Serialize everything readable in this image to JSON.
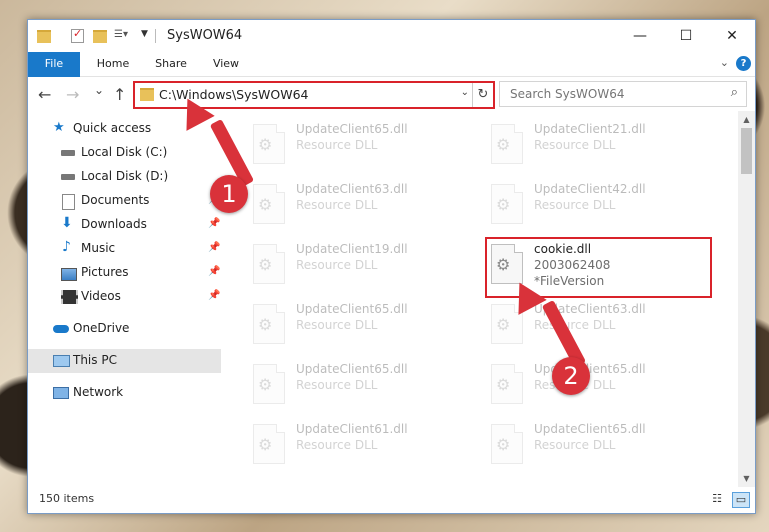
{
  "window": {
    "title": "SysWOW64",
    "controls": {
      "minimize": "—",
      "maximize": "☐",
      "close": "✕"
    }
  },
  "ribbon": {
    "tabs": [
      "File",
      "Home",
      "Share",
      "View"
    ],
    "help": "?"
  },
  "nav_buttons": {
    "back": "←",
    "forward": "→",
    "recent": "⌄",
    "up": "↑"
  },
  "address": {
    "path": "C:\\Windows\\SysWOW64",
    "dropdown": "⌄",
    "refresh": "↻"
  },
  "search": {
    "placeholder": "Search SysWOW64"
  },
  "sidebar": {
    "items": [
      {
        "label": "Quick access",
        "icon": "star-icon"
      },
      {
        "label": "Local Disk (C:)",
        "icon": "drive-icon"
      },
      {
        "label": "Local Disk (D:)",
        "icon": "drive-icon"
      },
      {
        "label": "Documents",
        "icon": "documents-icon"
      },
      {
        "label": "Downloads",
        "icon": "download-icon"
      },
      {
        "label": "Music",
        "icon": "music-icon"
      },
      {
        "label": "Pictures",
        "icon": "pictures-icon"
      },
      {
        "label": "Videos",
        "icon": "videos-icon"
      },
      {
        "label": "OneDrive",
        "icon": "cloud-icon"
      },
      {
        "label": "This PC",
        "icon": "computer-icon"
      },
      {
        "label": "Network",
        "icon": "network-icon"
      }
    ]
  },
  "files": [
    {
      "name": "UpdateClient65.dll",
      "type": "Resource DLL"
    },
    {
      "name": "UpdateClient21.dll",
      "type": "Resource DLL"
    },
    {
      "name": "UpdateClient63.dll",
      "type": "Resource DLL"
    },
    {
      "name": "UpdateClient42.dll",
      "type": "Resource DLL"
    },
    {
      "name": "UpdateClient19.dll",
      "type": "Resource DLL"
    },
    {
      "name": "UpdateClient65.dll",
      "type": "Resource DLL"
    },
    {
      "name": "UpdateClient63.dll",
      "type": "Resource DLL"
    },
    {
      "name": "UpdateClient65.dll",
      "type": "Resource DLL"
    },
    {
      "name": "UpdateClient65.dll",
      "type": "Resource DLL"
    },
    {
      "name": "UpdateClient61.dll",
      "type": "Resource DLL"
    },
    {
      "name": "UpdateClient65.dll",
      "type": "Resource DLL"
    }
  ],
  "highlighted_file": {
    "name": "cookie.dll",
    "version": "2003062408",
    "description": "*FileVersion"
  },
  "status": {
    "item_count": "150 items"
  },
  "annotations": {
    "step1": "1",
    "step2": "2",
    "color": "#d9323a"
  }
}
